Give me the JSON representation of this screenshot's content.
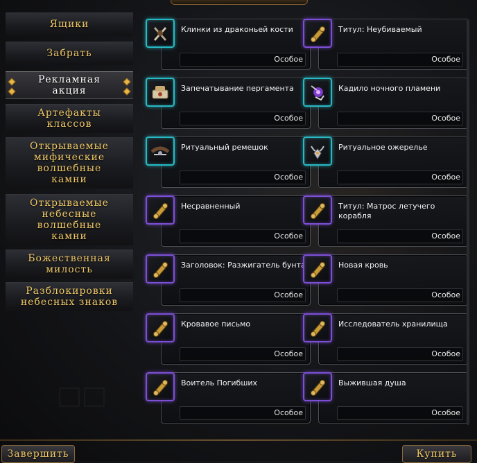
{
  "sidebar": {
    "items": [
      {
        "label": "Ящики",
        "active": false
      },
      {
        "label": "Забрать",
        "active": false
      },
      {
        "label": "Рекламная\nакция",
        "active": true
      },
      {
        "label": "Артефакты\nклассов",
        "active": false
      },
      {
        "label": "Открываемые\nмифические\nволшебные\nкамни",
        "active": false
      },
      {
        "label": "Открываемые\nнебесные\nволшебные\nкамни",
        "active": false
      },
      {
        "label": "Божественная\nмилость",
        "active": false
      },
      {
        "label": "Разблокировки\nнебесных знаков",
        "active": false
      }
    ]
  },
  "items": [
    {
      "name": "Клинки из драконьей кости",
      "type": "Особое",
      "icon": "dragonbone-blades-icon",
      "rarity_color": "#29b9c4"
    },
    {
      "name": "Титул: Неубиваемый",
      "type": "Особое",
      "icon": "scroll-icon",
      "rarity_color": "#7d4fd6"
    },
    {
      "name": "Запечатывание пергамента",
      "type": "Особое",
      "icon": "parchment-seal-icon",
      "rarity_color": "#29b9c4"
    },
    {
      "name": "Кадило ночного пламени",
      "type": "Особое",
      "icon": "censer-icon",
      "rarity_color": "#7d4fd6"
    },
    {
      "name": "Ритуальный ремешок",
      "type": "Особое",
      "icon": "ritual-strap-icon",
      "rarity_color": "#29b9c4"
    },
    {
      "name": "Ритуальное ожерелье",
      "type": "Особое",
      "icon": "ritual-necklace-icon",
      "rarity_color": "#29b9c4"
    },
    {
      "name": "Несравненный",
      "type": "Особое",
      "icon": "scroll-icon",
      "rarity_color": "#7d4fd6"
    },
    {
      "name": "Титул: Матрос летучего корабля",
      "type": "Особое",
      "icon": "scroll-icon",
      "rarity_color": "#7d4fd6"
    },
    {
      "name": "Заголовок: Разжигатель бунта",
      "type": "Особое",
      "icon": "scroll-icon",
      "rarity_color": "#7d4fd6"
    },
    {
      "name": "Новая кровь",
      "type": "Особое",
      "icon": "scroll-icon",
      "rarity_color": "#7d4fd6"
    },
    {
      "name": "Кровавое письмо",
      "type": "Особое",
      "icon": "scroll-icon",
      "rarity_color": "#7d4fd6"
    },
    {
      "name": "Исследователь хранилища",
      "type": "Особое",
      "icon": "scroll-icon",
      "rarity_color": "#7d4fd6"
    },
    {
      "name": "Воитель Погибших",
      "type": "Особое",
      "icon": "scroll-icon",
      "rarity_color": "#7d4fd6"
    },
    {
      "name": "Выжившая душа",
      "type": "Особое",
      "icon": "scroll-icon",
      "rarity_color": "#7d4fd6"
    }
  ],
  "footer": {
    "finish_label": "Завершить",
    "buy_label": "Купить"
  }
}
